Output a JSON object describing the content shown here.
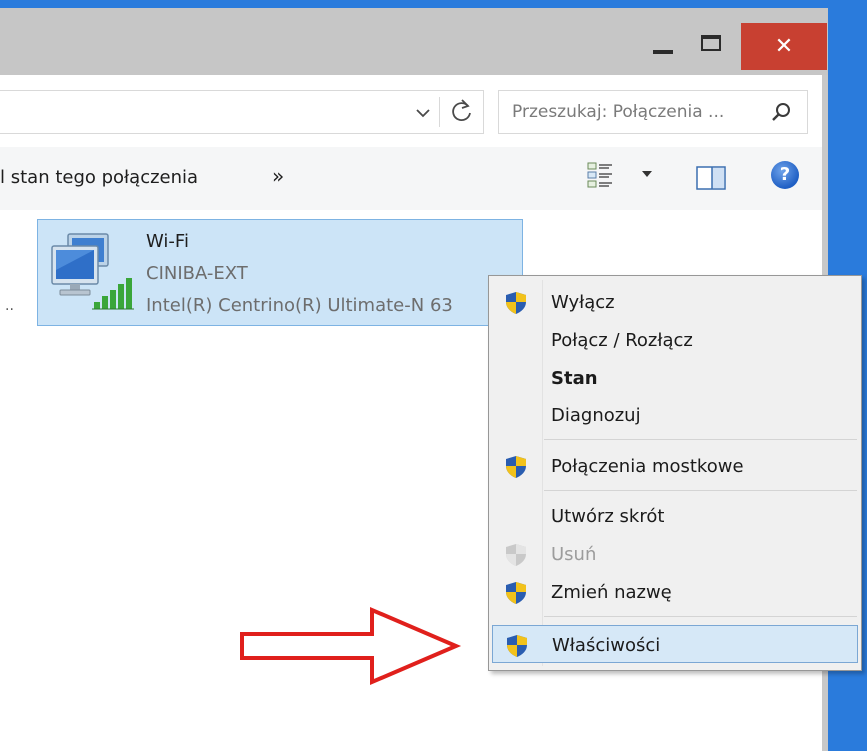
{
  "window": {
    "close_glyph": "✕",
    "accent_color": "#2a7bdc",
    "close_color": "#c84031"
  },
  "address": {
    "search_placeholder": "Przeszukaj: Połączenia ..."
  },
  "toolbar": {
    "command_text": "l stan tego połączenia",
    "more_label": "»",
    "help_label": "?"
  },
  "content": {
    "truncated_label": "..",
    "connection": {
      "name": "Wi-Fi",
      "ssid": "CINIBA-EXT",
      "adapter": "Intel(R) Centrino(R) Ultimate-N 63",
      "icon": "wireless-network-icon"
    }
  },
  "context_menu": {
    "items": [
      {
        "label": "Wyłącz",
        "icon": "uac-shield-icon"
      },
      {
        "label": "Połącz / Rozłącz"
      },
      {
        "label": "Stan",
        "bold": true
      },
      {
        "label": "Diagnozuj"
      },
      {
        "label": "Połączenia mostkowe",
        "icon": "uac-shield-icon"
      },
      {
        "label": "Utwórz skrót"
      },
      {
        "label": "Usuń",
        "icon": "uac-shield-icon",
        "disabled": true
      },
      {
        "label": "Zmień nazwę",
        "icon": "uac-shield-icon"
      },
      {
        "label": "Właściwości",
        "icon": "uac-shield-icon",
        "highlighted": true
      }
    ]
  },
  "annotation": {
    "arrow_color": "#e0201c"
  }
}
